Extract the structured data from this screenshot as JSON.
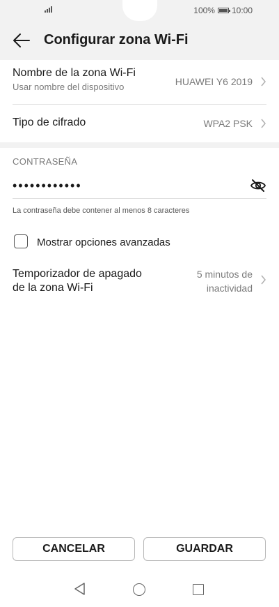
{
  "status_bar": {
    "battery": "100%",
    "time": "10:00"
  },
  "app_bar": {
    "title": "Configurar zona Wi-Fi"
  },
  "hotspot_name": {
    "label": "Nombre de la zona Wi-Fi",
    "sublabel": "Usar nombre del dispositivo",
    "value": "HUAWEI Y6 2019"
  },
  "encryption": {
    "label": "Tipo de cifrado",
    "value": "WPA2 PSK"
  },
  "password": {
    "section_title": "CONTRASEÑA",
    "masked_value": "••••••••••••",
    "hint": "La contraseña debe contener al menos 8 caracteres"
  },
  "advanced": {
    "label": "Mostrar opciones avanzadas",
    "checked": false
  },
  "timer": {
    "label_line1": "Temporizador de apagado",
    "label_line2": "de la zona Wi-Fi",
    "value_line1": "5 minutos de",
    "value_line2": "inactividad"
  },
  "actions": {
    "cancel": "CANCELAR",
    "save": "GUARDAR"
  },
  "icons": {
    "back": "arrow-left-icon",
    "chevron": "chevron-right-icon",
    "eye": "eye-slash-icon",
    "nav_back": "triangle-back-icon",
    "nav_home": "circle-home-icon",
    "nav_recent": "square-recents-icon"
  }
}
